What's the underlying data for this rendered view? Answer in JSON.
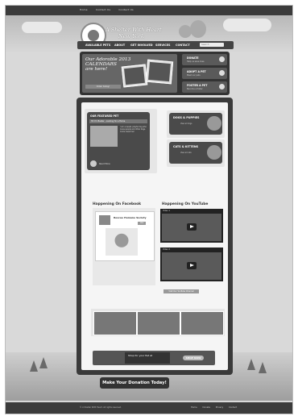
{
  "topbar": {
    "links": [
      "Home",
      "Contact Us",
      "Contact Us"
    ]
  },
  "brand": {
    "name_line1": "A Shelter With Heart",
    "name_line2": "New York"
  },
  "nav": {
    "items": [
      "AVAILABLE PETS",
      "ABOUT",
      "GET INVOLVED",
      "SERVICES",
      "CONTACT"
    ],
    "search_placeholder": "Search"
  },
  "hero": {
    "banner_text": [
      "Our Adorable 2013",
      "CALENDARS",
      "are here!"
    ],
    "banner_sub": "Order today!",
    "ctas": [
      {
        "title": "DONATE",
        "subtitle": "Help us save lives"
      },
      {
        "title": "ADOPT A PET",
        "subtitle": "Meet our pets"
      },
      {
        "title": "FOSTER A PET",
        "subtitle": "Become a foster"
      }
    ]
  },
  "featured": {
    "heading": "OUR FEATURED PET",
    "pet_line": "Hi! I'm Buster - Looking for a Home",
    "description": "I am a sweet, playful dog who loves people and other dogs. Come meet me!",
    "more_label": "Read More"
  },
  "categories": [
    {
      "title": "DOGS & PUPPIES",
      "subtitle": "View all dogs"
    },
    {
      "title": "CATS & KITTENS",
      "subtitle": "View all cats"
    }
  ],
  "facebook": {
    "heading": "Happening On Facebook",
    "page_name": "Rescue Humane Society",
    "like_label": "Like"
  },
  "youtube": {
    "heading": "Happening On YouTube",
    "videos": [
      {
        "title": "Video 1"
      },
      {
        "title": "Video 2"
      }
    ],
    "button_label": "Visit Our YouTube Channel"
  },
  "ad": {
    "brand_text": "Shop for your Pet at",
    "shop_label": "SHOP NOW"
  },
  "donate": {
    "label": "Make Your Donation Today!"
  },
  "footer": {
    "copyright": "© A Shelter With Heart. All rights reserved.",
    "links": [
      "Home",
      "Donate",
      "Privacy",
      "Contact"
    ]
  }
}
